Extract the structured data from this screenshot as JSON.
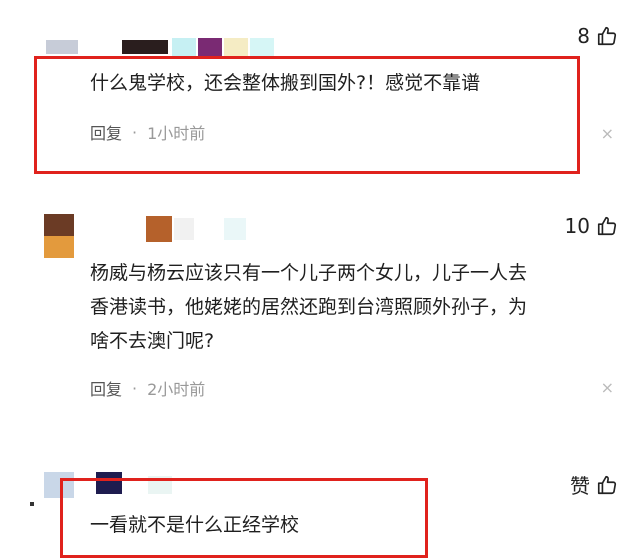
{
  "comments": [
    {
      "likes": "8",
      "text": "什么鬼学校，还会整体搬到国外?！感觉不靠谱",
      "reply_label": "回复",
      "separator": "·",
      "time": "1小时前",
      "close_glyph": "×"
    },
    {
      "likes": "10",
      "text_lines": [
        "杨威与杨云应该只有一个儿子两个女儿，儿子一人去",
        "香港读书，他姥姥的居然还跑到台湾照顾外孙子，为",
        "啥不去澳门呢?"
      ],
      "reply_label": "回复",
      "separator": "·",
      "time": "2小时前",
      "close_glyph": "×"
    },
    {
      "likes": "赞",
      "text": "一看就不是什么正经学校"
    }
  ],
  "colors": {
    "highlight_box": "#e0221d"
  },
  "icons": [
    "thumbs-up-icon",
    "close-icon"
  ]
}
